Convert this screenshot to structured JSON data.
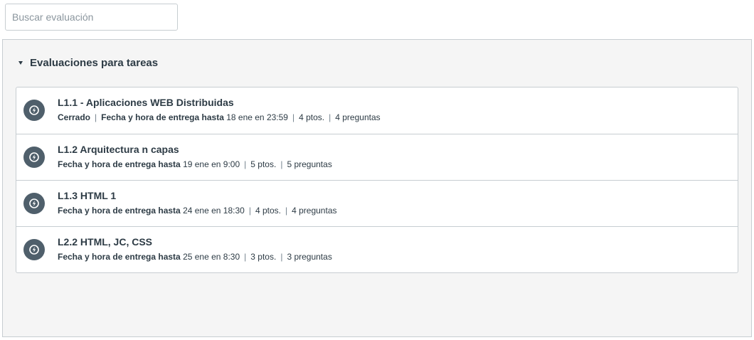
{
  "search": {
    "placeholder": "Buscar evaluación",
    "value": ""
  },
  "group": {
    "title": "Evaluaciones para tareas"
  },
  "items": [
    {
      "icon": "quiz-icon",
      "title": "L1.1 - Aplicaciones WEB Distribuidas",
      "status": "Cerrado",
      "due_label": "Fecha y hora de entrega hasta",
      "due_date": "18 ene en 23:59",
      "points": "4 ptos.",
      "questions": "4 preguntas"
    },
    {
      "icon": "quiz-icon",
      "title": "L1.2 Arquitectura n capas",
      "status": "",
      "due_label": "Fecha y hora de entrega hasta",
      "due_date": "19 ene en 9:00",
      "points": "5 ptos.",
      "questions": "5 preguntas"
    },
    {
      "icon": "quiz-icon",
      "title": "L1.3 HTML 1",
      "status": "",
      "due_label": "Fecha y hora de entrega hasta",
      "due_date": "24 ene en 18:30",
      "points": "4 ptos.",
      "questions": "4 preguntas"
    },
    {
      "icon": "quiz-icon",
      "title": "L2.2 HTML, JC, CSS",
      "status": "",
      "due_label": "Fecha y hora de entrega hasta",
      "due_date": "25 ene en 8:30",
      "points": "3 ptos.",
      "questions": "3 preguntas"
    }
  ],
  "separator": "|",
  "colors": {
    "icon_bg": "#4f5f6b",
    "text": "#2d3b45",
    "border": "#c7cdd1",
    "panel_bg": "#f5f5f5"
  }
}
